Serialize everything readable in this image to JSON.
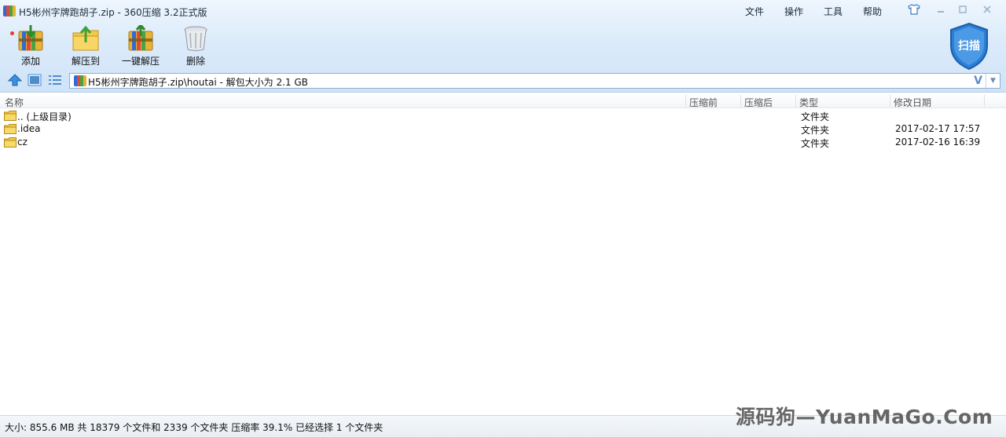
{
  "window": {
    "title": "H5彬州字牌跑胡子.zip - 360压缩 3.2正式版",
    "app_icon": "360zip-app-icon"
  },
  "menu": {
    "file": "文件",
    "operate": "操作",
    "tools": "工具",
    "help": "帮助"
  },
  "toolbar": {
    "add": "添加",
    "extract_to": "解压到",
    "one_click_extract": "一键解压",
    "delete": "删除",
    "scan": "扫描"
  },
  "address": {
    "path": "H5彬州字牌跑胡子.zip\\houtai - 解包大小为 2.1 GB",
    "v_label": "V"
  },
  "columns": {
    "name": "名称",
    "before": "压缩前",
    "after": "压缩后",
    "type": "类型",
    "modified": "修改日期"
  },
  "rows": [
    {
      "name": ".. (上级目录)",
      "type": "文件夹",
      "modified": ""
    },
    {
      "name": ".idea",
      "type": "文件夹",
      "modified": "2017-02-17 17:57"
    },
    {
      "name": "cz",
      "type": "文件夹",
      "modified": "2017-02-16 16:39"
    }
  ],
  "status": {
    "text": "大小: 855.6 MB 共 18379 个文件和 2339 个文件夹 压缩率 39.1% 已经选择 1 个文件夹"
  },
  "watermark": "源码狗—YuanMaGo.Com",
  "colors": {
    "chrome_bg": "#dcebfa",
    "accent_blue": "#2f7fd8",
    "folder_yellow": "#f2c94c"
  }
}
